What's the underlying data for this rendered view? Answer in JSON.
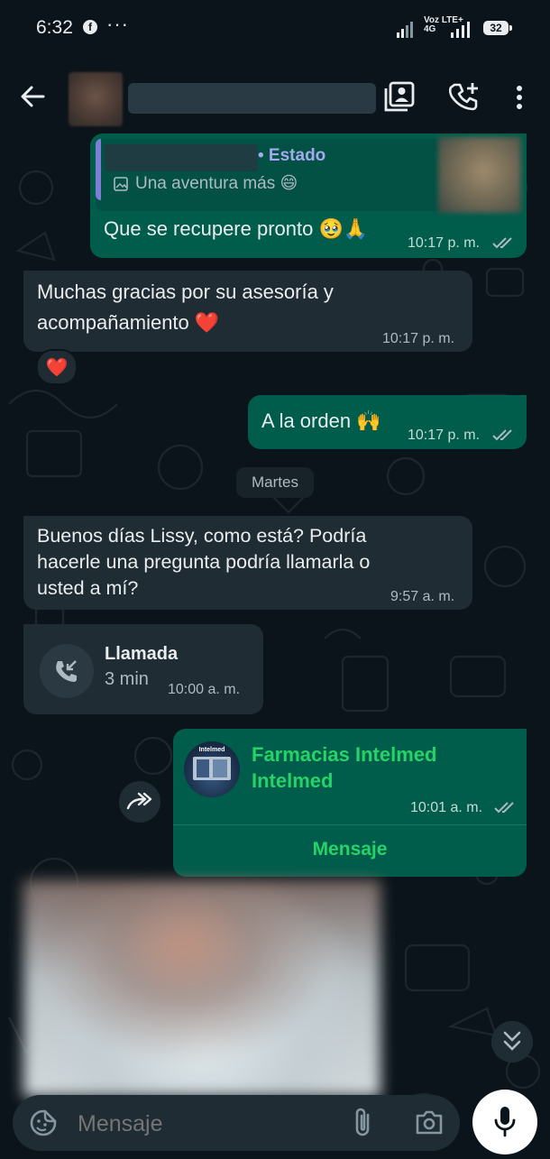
{
  "status_bar": {
    "time": "6:32",
    "network_top": "Voz LTE+",
    "network_bottom": "4G",
    "battery": "32"
  },
  "header": {
    "icons": [
      "back-arrow-icon",
      "contact-card-icon",
      "add-call-icon",
      "more-vert-icon"
    ]
  },
  "messages": {
    "reply_to_status": {
      "quote_label": "• Estado",
      "quote_text": "Una aventura más 😄",
      "text": "Que se recupere pronto 🥹🙏",
      "time": "10:17 p. m."
    },
    "thanks": {
      "text_line1": "Muchas gracias por su asesoría y",
      "text_line2": "acompañamiento ❤️",
      "time": "10:17 p. m.",
      "reaction": "❤️"
    },
    "a_la_orden": {
      "text": "A la orden 🙌",
      "time": "10:17 p. m."
    },
    "date_chip": "Martes",
    "question": {
      "line1": "Buenos días Lissy, como está? Podría",
      "line2": "hacerle una pregunta podría llamarla o",
      "line3": "usted a mí?",
      "time": "9:57 a. m."
    },
    "call": {
      "title": "Llamada",
      "duration": "3 min",
      "time": "10:00 a. m."
    },
    "contact_share": {
      "name_line1": "Farmacias Intelmed",
      "name_line2": "Intelmed",
      "time": "10:01 a. m.",
      "action": "Mensaje",
      "logo_text": "Intelmed"
    }
  },
  "input": {
    "placeholder": "Mensaje"
  },
  "colors": {
    "bg": "#0b141a",
    "incoming": "#202c33",
    "outgoing": "#005c4b",
    "accent": "#25d366",
    "quote_bar": "#7d7fd6"
  }
}
